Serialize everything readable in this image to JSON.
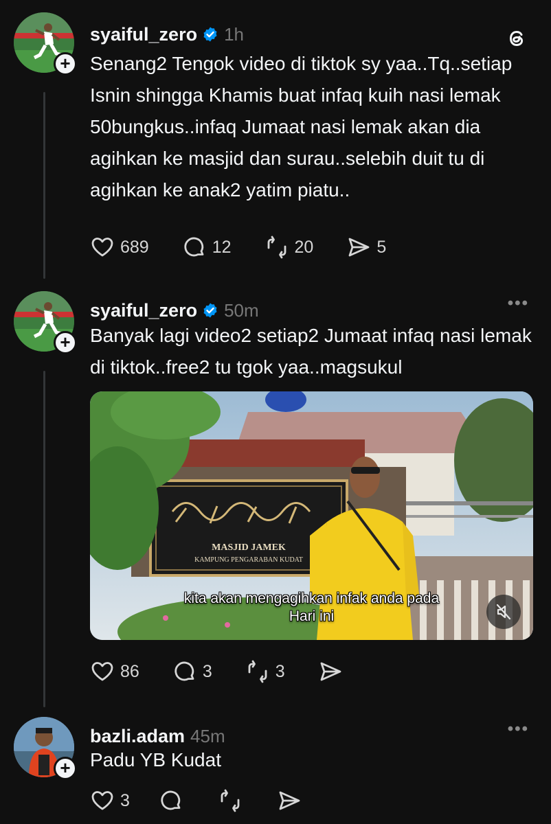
{
  "posts": [
    {
      "username": "syaiful_zero",
      "time": "1h",
      "text": "Senang2 Tengok video di tiktok sy yaa..Tq..setiap Isnin shingga Khamis buat infaq kuih nasi lemak 50bungkus..infaq Jumaat nasi lemak akan dia agihkan ke masjid dan surau..selebih duit tu di agihkan ke anak2 yatim piatu..",
      "likes": "689",
      "replies": "12",
      "reposts": "20",
      "shares": "5"
    },
    {
      "username": "syaiful_zero",
      "time": "50m",
      "text": "Banyak lagi video2 setiap2 Jumaat infaq nasi lemak di tiktok..free2 tu tgok yaa..magsukul",
      "video": {
        "sign_title": "MASJID JAMEK",
        "sign_subtitle": "KAMPUNG PENGARABAN KUDAT",
        "caption_line1": "kita akan mengagihkan infak anda pada",
        "caption_line2": "Hari ini"
      },
      "likes": "86",
      "replies": "3",
      "reposts": "3",
      "shares": ""
    },
    {
      "username": "bazli.adam",
      "time": "45m",
      "text": "Padu YB Kudat",
      "likes": "3",
      "replies": "",
      "reposts": "",
      "shares": ""
    }
  ],
  "colors": {
    "background": "#101010",
    "text": "#f3f5f7",
    "muted": "#777777",
    "verified": "#0095f6"
  }
}
